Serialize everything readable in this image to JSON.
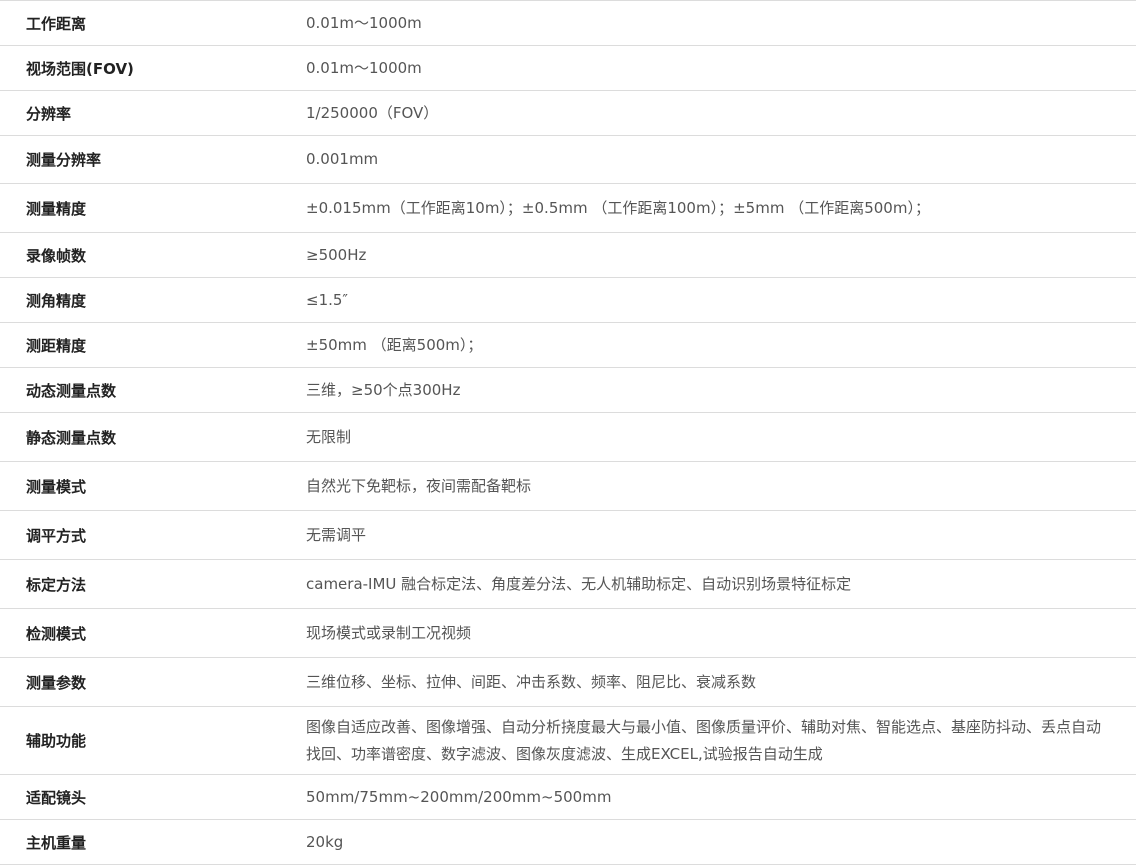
{
  "specs": [
    {
      "label": "工作距离",
      "value": "0.01m～1000m",
      "h": 45
    },
    {
      "label": "视场范围(FOV)",
      "value": "0.01m～1000m",
      "h": 45
    },
    {
      "label": "分辨率",
      "value": "1/250000（FOV）",
      "h": 45
    },
    {
      "label": "测量分辨率",
      "value": "0.001mm",
      "h": 48
    },
    {
      "label": "测量精度",
      "value": "±0.015mm（工作距离10m）；±0.5mm （工作距离100m）；±5mm （工作距离500m）；",
      "h": 49
    },
    {
      "label": "录像帧数",
      "value": "≥500Hz",
      "h": 45
    },
    {
      "label": "测角精度",
      "value": "≤1.5″",
      "h": 45
    },
    {
      "label": "测距精度",
      "value": "±50mm （距离500m）；",
      "h": 45
    },
    {
      "label": "动态测量点数",
      "value": "三维，≥50个点300Hz",
      "h": 45
    },
    {
      "label": "静态测量点数",
      "value": "无限制",
      "h": 49
    },
    {
      "label": "测量模式",
      "value": "自然光下免靶标，夜间需配备靶标",
      "h": 49
    },
    {
      "label": "调平方式",
      "value": "无需调平",
      "h": 49
    },
    {
      "label": "标定方法",
      "value": "camera-IMU 融合标定法、角度差分法、无人机辅助标定、自动识别场景特征标定",
      "h": 49
    },
    {
      "label": "检测模式",
      "value": "现场模式或录制工况视频",
      "h": 49
    },
    {
      "label": "测量参数",
      "value": "三维位移、坐标、拉伸、间距、冲击系数、频率、阻尼比、衰减系数",
      "h": 49
    },
    {
      "label": "辅助功能",
      "value": "图像自适应改善、图像增强、自动分析挠度最大与最小值、图像质量评价、辅助对焦、智能选点、基座防抖动、丢点自动找回、功率谱密度、数字滤波、图像灰度滤波、生成EXCEL,试验报告自动生成",
      "h": 68
    },
    {
      "label": "适配镜头",
      "value": "50mm/75mm~200mm/200mm~500mm",
      "h": 45
    },
    {
      "label": "主机重量",
      "value": "20kg",
      "h": 45
    }
  ]
}
